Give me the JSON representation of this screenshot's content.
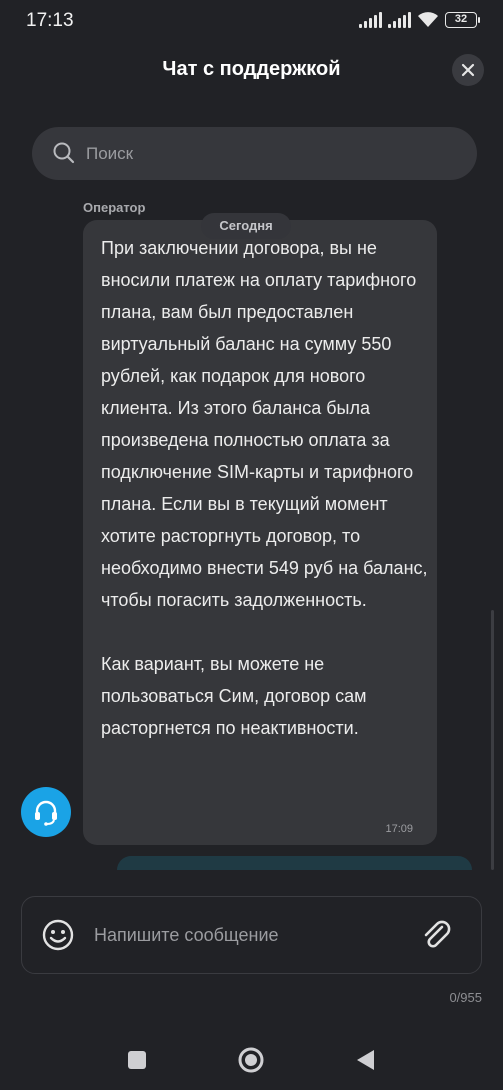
{
  "status_bar": {
    "time": "17:13",
    "battery": "32"
  },
  "header": {
    "title": "Чат с поддержкой",
    "close_icon": "close-icon"
  },
  "search": {
    "placeholder": "Поиск",
    "icon": "search-icon"
  },
  "chat": {
    "sender": "Оператор",
    "date_chip": "Сегодня",
    "message_text": "При заключении договора, вы не вносили платеж на оплату тарифного плана, вам был предоставлен виртуальный баланс на сумму 550 рублей, как подарок для нового клиента. Из этого баланса была произведена полностью оплата за подключение SIM-карты и тарифного плана. Если вы в текущий момент хотите расторгнуть договор, то необходимо внести 549 руб на баланс, чтобы погасить задолженность.\n\nКак вариант, вы можете не пользоваться Сим, договор сам расторгнется по неактивности.",
    "message_time": "17:09",
    "avatar_icon": "headset-icon"
  },
  "composer": {
    "placeholder": "Напишите сообщение",
    "counter": "0/955",
    "emoji_icon": "smiley-icon",
    "attach_icon": "paperclip-icon"
  },
  "nav": {
    "recents_icon": "square-icon",
    "home_icon": "circle-icon",
    "back_icon": "triangle-back-icon"
  },
  "colors": {
    "background": "#212226",
    "bubble": "#36373b",
    "accent": "#1aa3e6"
  }
}
